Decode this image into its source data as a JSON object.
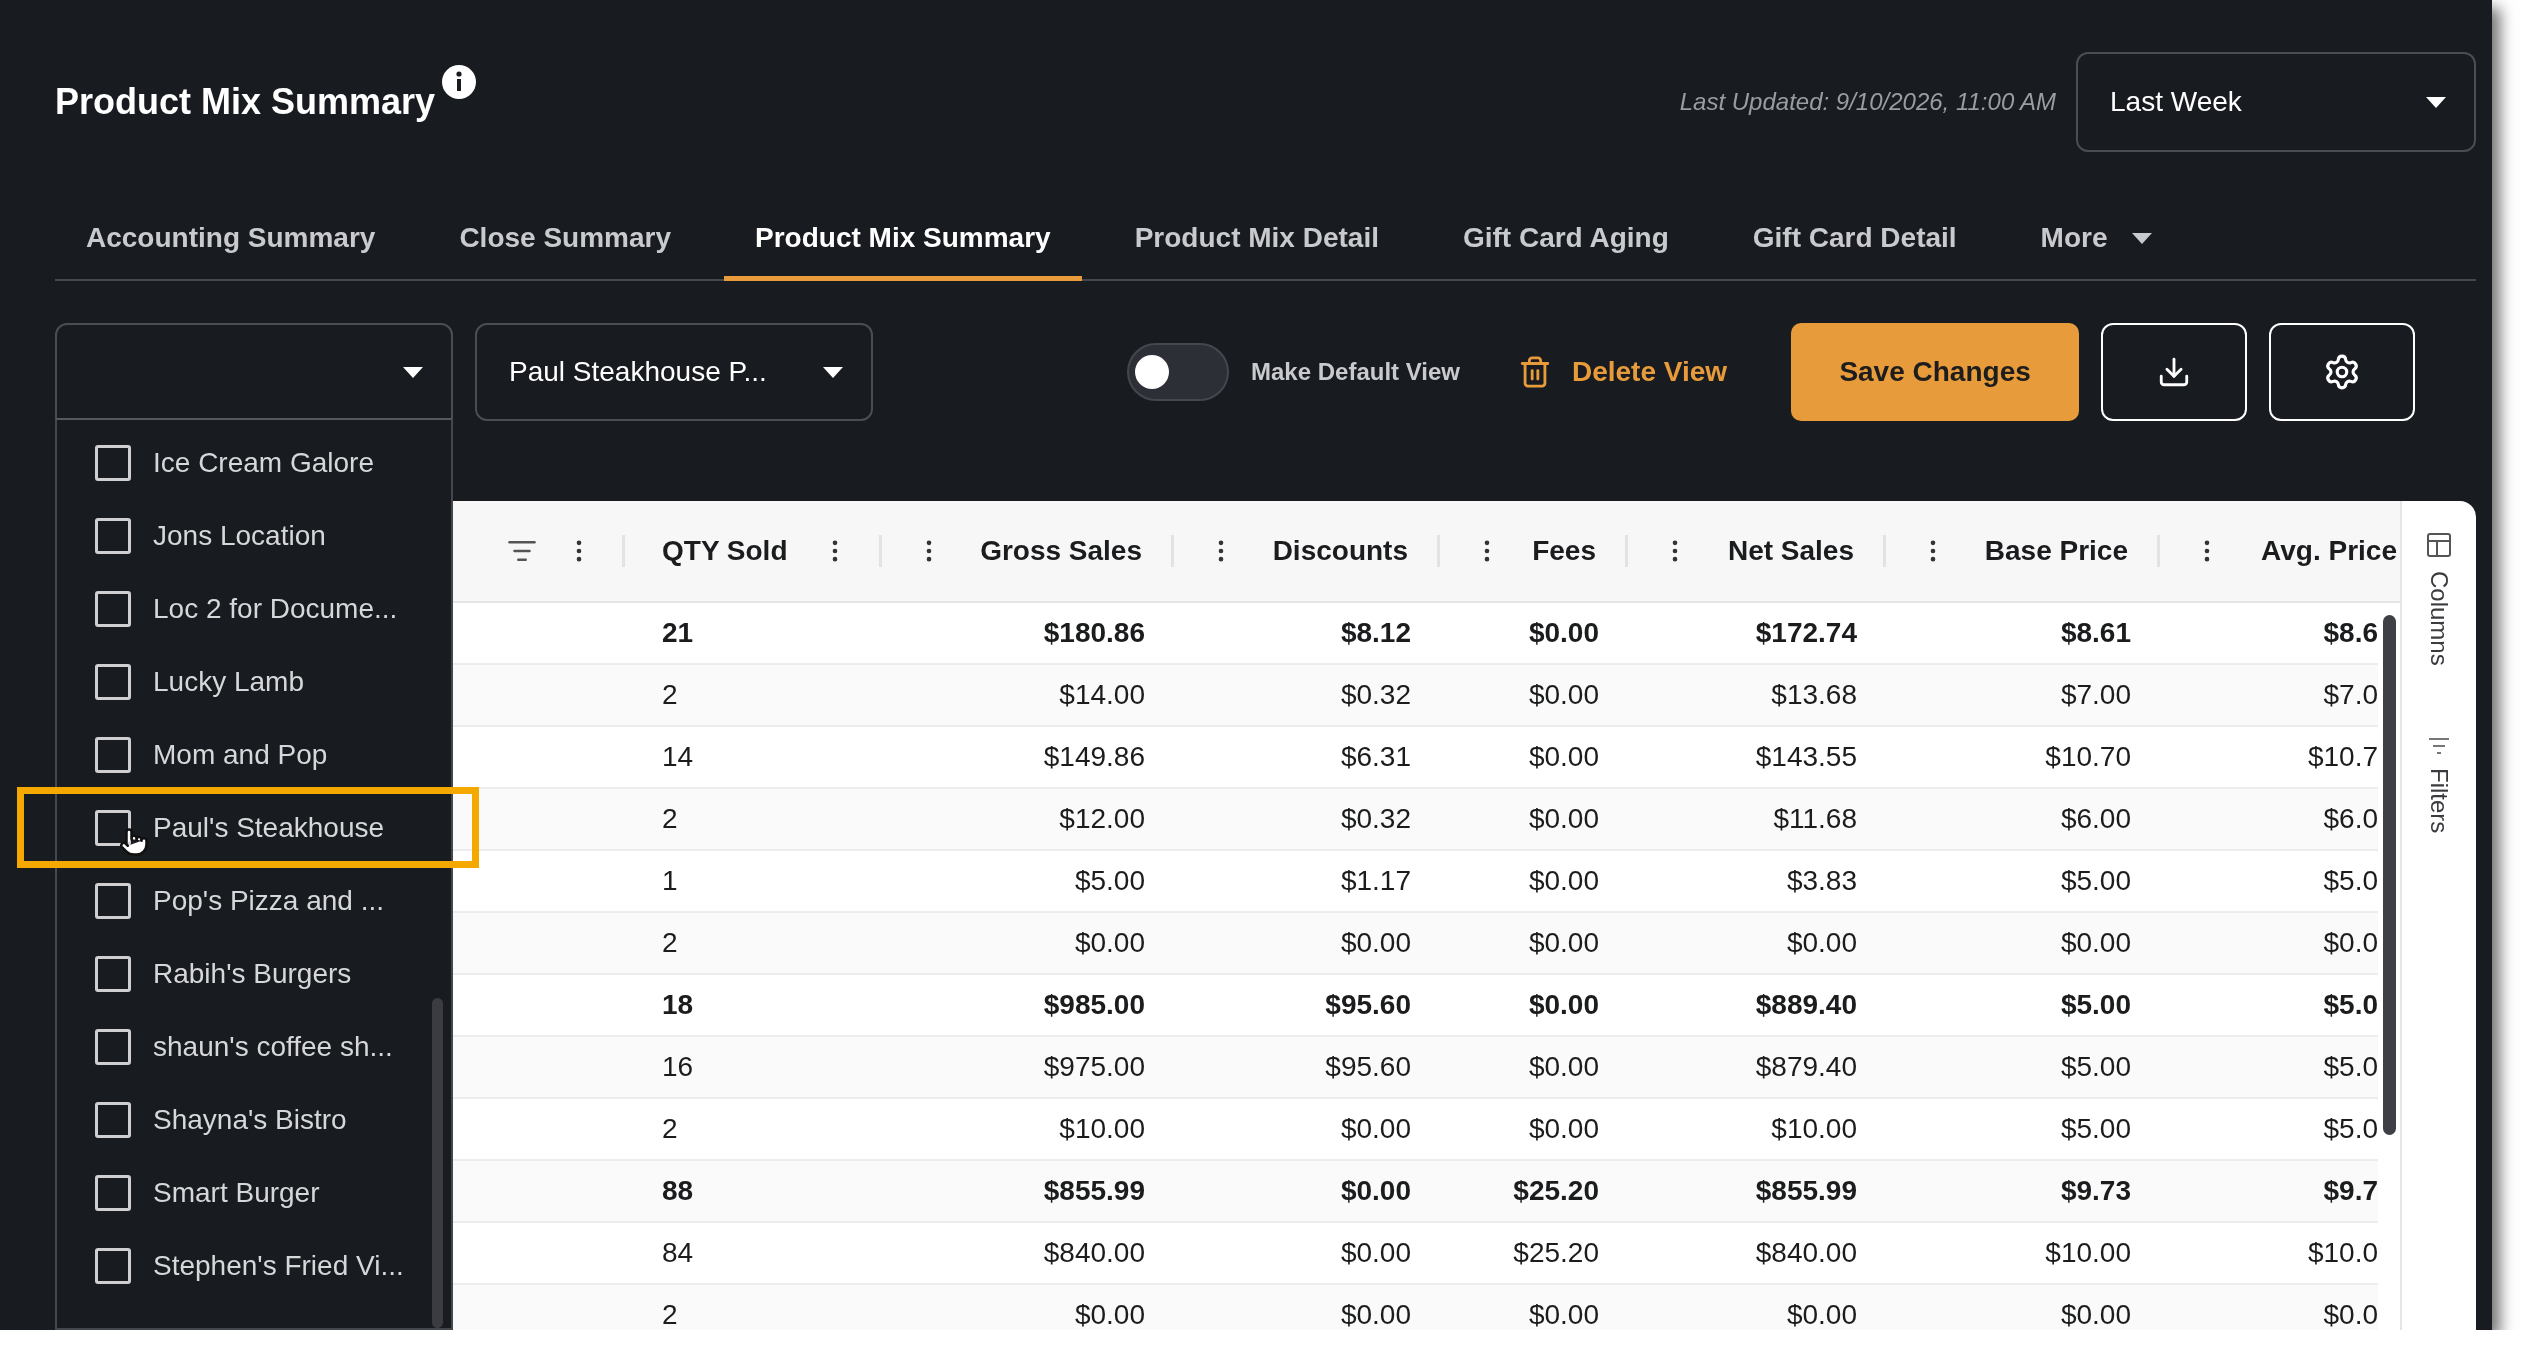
{
  "header": {
    "title": "Product Mix Summary",
    "last_updated": "Last Updated: 9/10/2026, 11:00 AM",
    "period": "Last Week"
  },
  "tabs": [
    {
      "label": "Accounting Summary",
      "selected": false
    },
    {
      "label": "Close Summary",
      "selected": false
    },
    {
      "label": "Product Mix Summary",
      "selected": true
    },
    {
      "label": "Product Mix Detail",
      "selected": false
    },
    {
      "label": "Gift Card Aging",
      "selected": false
    },
    {
      "label": "Gift Card Detail",
      "selected": false
    },
    {
      "label": "More",
      "selected": false,
      "kind": "menu"
    }
  ],
  "toolbar": {
    "view": "Paul Steakhouse P...",
    "default_view": {
      "label": "Make Default View",
      "on": false
    },
    "delete_label": "Delete View",
    "save_label": "Save Changes"
  },
  "location_filter": {
    "expanded": true,
    "items": [
      {
        "label": "Ice Cream Galore",
        "checked": false,
        "highlighted": false
      },
      {
        "label": "Jons Location",
        "checked": false,
        "highlighted": false
      },
      {
        "label": "Loc 2 for Docume...",
        "checked": false,
        "highlighted": false
      },
      {
        "label": "Lucky Lamb",
        "checked": false,
        "highlighted": false
      },
      {
        "label": "Mom and Pop",
        "checked": false,
        "highlighted": false
      },
      {
        "label": "Paul's Steakhouse",
        "checked": false,
        "highlighted": true
      },
      {
        "label": "Pop's Pizza and ...",
        "checked": false,
        "highlighted": false
      },
      {
        "label": "Rabih's Burgers",
        "checked": false,
        "highlighted": false
      },
      {
        "label": "shaun's coffee sh...",
        "checked": false,
        "highlighted": false
      },
      {
        "label": "Shayna's Bistro",
        "checked": false,
        "highlighted": false
      },
      {
        "label": "Smart Burger",
        "checked": false,
        "highlighted": false
      },
      {
        "label": "Stephen's Fried Vi...",
        "checked": false,
        "highlighted": false
      }
    ]
  },
  "table": {
    "columns": [
      "QTY Sold",
      "Gross Sales",
      "Discounts",
      "Fees",
      "Net Sales",
      "Base Price",
      "Avg. Price"
    ],
    "rows": [
      {
        "kind": "group",
        "cells": [
          "21",
          "$180.86",
          "$8.12",
          "$0.00",
          "$172.74",
          "$8.61",
          "$8.6"
        ]
      },
      {
        "kind": "item",
        "cells": [
          "2",
          "$14.00",
          "$0.32",
          "$0.00",
          "$13.68",
          "$7.00",
          "$7.0"
        ]
      },
      {
        "kind": "item",
        "cells": [
          "14",
          "$149.86",
          "$6.31",
          "$0.00",
          "$143.55",
          "$10.70",
          "$10.7"
        ]
      },
      {
        "kind": "item",
        "cells": [
          "2",
          "$12.00",
          "$0.32",
          "$0.00",
          "$11.68",
          "$6.00",
          "$6.0"
        ]
      },
      {
        "kind": "item",
        "cells": [
          "1",
          "$5.00",
          "$1.17",
          "$0.00",
          "$3.83",
          "$5.00",
          "$5.0"
        ]
      },
      {
        "kind": "item",
        "cells": [
          "2",
          "$0.00",
          "$0.00",
          "$0.00",
          "$0.00",
          "$0.00",
          "$0.0"
        ]
      },
      {
        "kind": "group",
        "cells": [
          "18",
          "$985.00",
          "$95.60",
          "$0.00",
          "$889.40",
          "$5.00",
          "$5.0"
        ]
      },
      {
        "kind": "item",
        "cells": [
          "16",
          "$975.00",
          "$95.60",
          "$0.00",
          "$879.40",
          "$5.00",
          "$5.0"
        ]
      },
      {
        "kind": "item",
        "cells": [
          "2",
          "$10.00",
          "$0.00",
          "$0.00",
          "$10.00",
          "$5.00",
          "$5.0"
        ]
      },
      {
        "kind": "group",
        "cells": [
          "88",
          "$855.99",
          "$0.00",
          "$25.20",
          "$855.99",
          "$9.73",
          "$9.7"
        ]
      },
      {
        "kind": "item",
        "cells": [
          "84",
          "$840.00",
          "$0.00",
          "$25.20",
          "$840.00",
          "$10.00",
          "$10.0"
        ]
      },
      {
        "kind": "item",
        "cells": [
          "2",
          "$0.00",
          "$0.00",
          "$0.00",
          "$0.00",
          "$0.00",
          "$0.0"
        ]
      }
    ]
  },
  "side_panel": [
    "Columns",
    "Filters"
  ]
}
